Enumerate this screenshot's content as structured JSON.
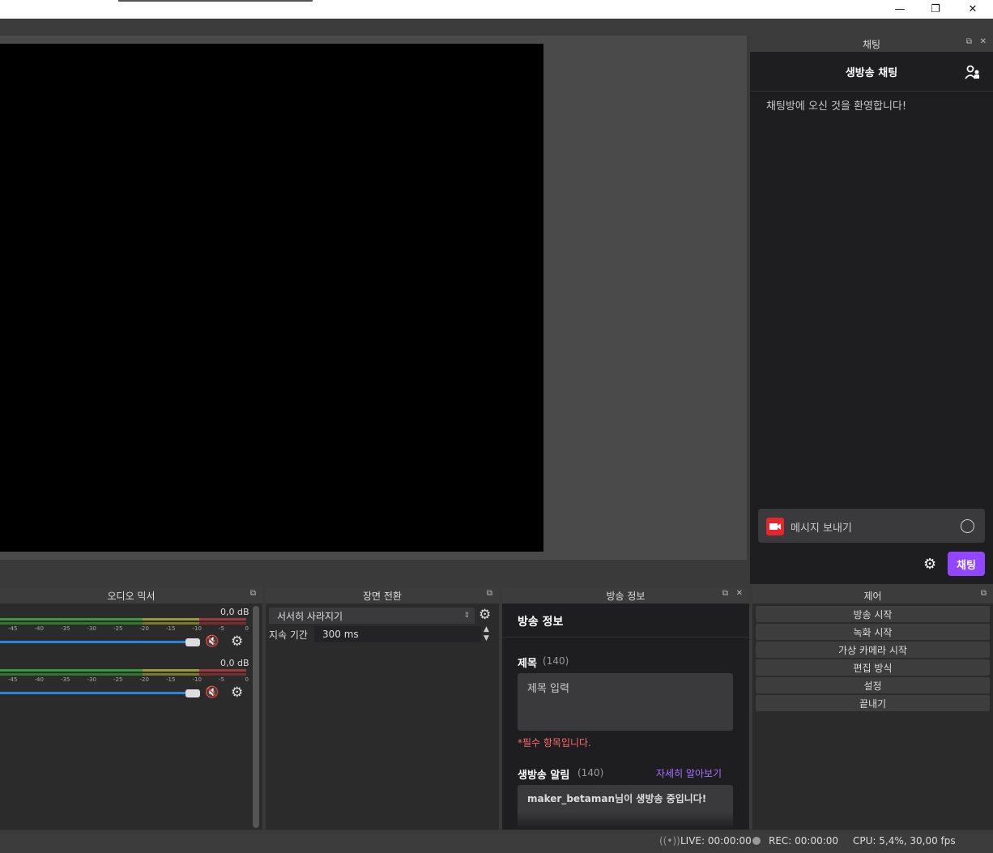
{
  "window": {
    "minimize": "—",
    "restore": "❐",
    "close": "✕"
  },
  "chat": {
    "dock_title": "채팅",
    "header": "생방송 채팅",
    "welcome": "채팅방에 오신 것을 환영합니다!",
    "input_placeholder": "메시지 보내기",
    "send_label": "채팅"
  },
  "mixer": {
    "dock_title": "오디오 믹서",
    "tracks": [
      {
        "db": "0,0 dB",
        "scale": [
          "-45",
          "-40",
          "-35",
          "-30",
          "-25",
          "-20",
          "-15",
          "-10",
          "-5",
          "0"
        ]
      },
      {
        "db": "0,0 dB",
        "scale": [
          "-45",
          "-40",
          "-35",
          "-30",
          "-25",
          "-20",
          "-15",
          "-10",
          "-5",
          "0"
        ]
      }
    ]
  },
  "transition": {
    "dock_title": "장면 전환",
    "selected": "서서히 사라지기",
    "duration_label": "지속 기간",
    "duration_value": "300 ms"
  },
  "info": {
    "dock_title": "방송 정보",
    "heading": "방송 정보",
    "title_label": "제목",
    "title_count": "(140)",
    "title_placeholder": "제목 입력",
    "required": "*필수 항목입니다.",
    "notify_label": "생방송 알림",
    "notify_count": "(140)",
    "learn_more": "자세히 알아보기",
    "notify_value": "maker_betaman님이 생방송 중입니다!"
  },
  "controls": {
    "dock_title": "제어",
    "buttons": [
      "방송 시작",
      "녹화 시작",
      "가상 카메라 시작",
      "편집 방식",
      "설정",
      "끝내기"
    ]
  },
  "status": {
    "live": "LIVE: 00:00:00",
    "rec": "REC: 00:00:00",
    "cpu": "CPU: 5,4%, 30,00 fps"
  },
  "colors": {
    "accent": "#9147ff",
    "mute": "#e02020",
    "link": "#a970ff",
    "required": "#ff6b6b"
  }
}
